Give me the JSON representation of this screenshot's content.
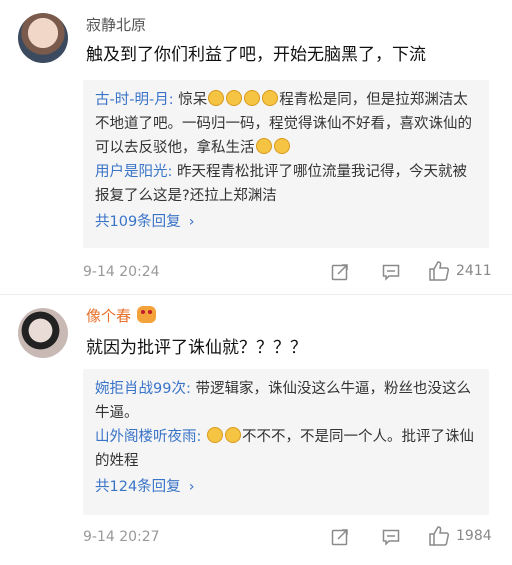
{
  "comments": [
    {
      "username": "寂静北原",
      "text": "触及到了你们利益了吧，开始无脑黑了，下流",
      "replies": [
        {
          "name": "古-时-明-月:",
          "before": " 惊呆",
          "after": "程青松是同，但是拉郑渊洁太不地道了吧。一码归一码，程觉得诛仙不好看，喜欢诛仙的可以去反驳他，拿私生活"
        },
        {
          "name": "用户是阳光:",
          "text": " 昨天程青松批评了哪位流量我记得，今天就被报复了么这是?还拉上郑渊洁"
        }
      ],
      "more": "共109条回复",
      "time": "9-14 20:24",
      "likes": "2411"
    },
    {
      "username": "像个春",
      "text": "就因为批评了诛仙就？？？？",
      "replies": [
        {
          "name": "婉拒肖战99次:",
          "text": " 带逻辑家，诛仙没这么牛逼，粉丝也没这么牛逼。"
        },
        {
          "name": "山外阁楼听夜雨:",
          "before": " ",
          "after": "不不不，不是同一个人。批评了诛仙的姓程"
        }
      ],
      "more": "共124条回复",
      "time": "9-14 20:27",
      "likes": "1984"
    }
  ],
  "icons": {
    "share": "share-icon",
    "reply": "comment-icon",
    "like": "thumbs-up-icon",
    "chevron": "chevron-right-icon"
  },
  "colors": {
    "link": "#3a74c8",
    "username_highlight": "#e8722c"
  }
}
